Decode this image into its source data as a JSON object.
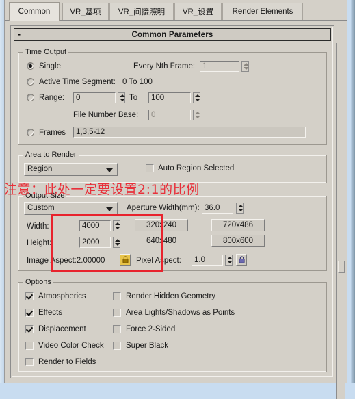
{
  "window": {
    "rollout_title": "Common Parameters",
    "rollout_toggle": "-"
  },
  "tabs": [
    {
      "label": "Common",
      "active": true
    },
    {
      "label": "VR_基项",
      "active": false
    },
    {
      "label": "VR_间接照明",
      "active": false
    },
    {
      "label": "VR_设置",
      "active": false
    },
    {
      "label": "Render Elements",
      "active": false
    }
  ],
  "time_output": {
    "title": "Time Output",
    "single_label": "Single",
    "active_segment_label": "Active Time Segment:",
    "active_segment_value": "0 To 100",
    "range_label": "Range:",
    "range_from": "0",
    "range_to_label": "To",
    "range_to": "100",
    "file_number_base_label": "File Number Base:",
    "file_number_base": "0",
    "frames_label": "Frames",
    "frames_value": "1,3,5-12",
    "every_nth_label": "Every Nth Frame:",
    "every_nth_value": "1",
    "selected": "single"
  },
  "area_to_render": {
    "title": "Area to Render",
    "mode": "Region",
    "auto_region_label": "Auto Region Selected",
    "auto_region_checked": false
  },
  "output_size": {
    "title": "Output Size",
    "preset": "Custom",
    "aperture_label": "Aperture Width(mm):",
    "aperture_value": "36.0",
    "width_label": "Width:",
    "width_value": "4000",
    "height_label": "Height:",
    "height_value": "2000",
    "image_aspect_label": "Image Aspect:2.00000",
    "pixel_aspect_label": "Pixel Aspect:",
    "pixel_aspect_value": "1.0",
    "presets": [
      "320x240",
      "720x486",
      "640x480",
      "800x600"
    ]
  },
  "options": {
    "title": "Options",
    "left": [
      {
        "label": "Atmospherics",
        "checked": true
      },
      {
        "label": "Effects",
        "checked": true
      },
      {
        "label": "Displacement",
        "checked": true
      },
      {
        "label": "Video Color Check",
        "checked": false
      },
      {
        "label": "Render to Fields",
        "checked": false
      }
    ],
    "right": [
      {
        "label": "Render Hidden Geometry",
        "checked": false
      },
      {
        "label": "Area Lights/Shadows as Points",
        "checked": false
      },
      {
        "label": "Force 2-Sided",
        "checked": false
      },
      {
        "label": "Super Black",
        "checked": false
      }
    ]
  },
  "annotation": {
    "text": "注意：此处一定要设置2:1的比例",
    "color": "#e8303a",
    "highlight_color": "#e8232d"
  }
}
